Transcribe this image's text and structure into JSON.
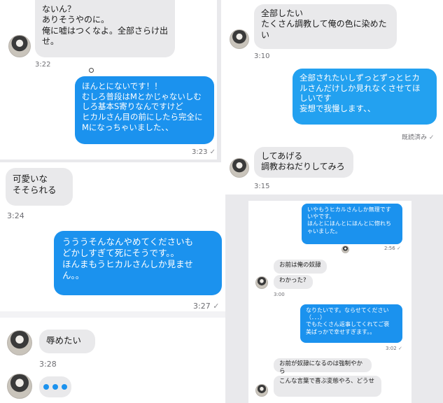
{
  "p1": {
    "m1": "ないん？\nありそうやのに。\n俺に嘘はつくなよ。全部さらけ出\nせ。",
    "t1": "3:22",
    "m2": "ほんとにないです！！\nむしろ普段はMとかじゃないしむ\nしろ基本S寄りなんですけど\nヒカルさん目の前にしたら完全に\nMになっちゃいました、、",
    "t2": "3:23",
    "check": "✓"
  },
  "p2": {
    "m1": "可愛いな\nそそられる",
    "t1": "3:24",
    "m2": "うううそんなんやめてくださいも\nどかしすぎて死にそうです。。\nほんまもうヒカルさんしか見ませ\nん。。",
    "t2": "3:27",
    "check": "✓",
    "m3": "辱めたい",
    "t3": "3:28"
  },
  "p3": {
    "m1": "全部したい\nたくさん調教して俺の色に染めた\nい",
    "t1": "3:10",
    "m2": "全部されたいしずっとずっとヒカ\nルさんだけしか見れなくさせてほ\nしいです\n妄想で我慢します、、",
    "read": "既読済み",
    "check": "✓",
    "m3": "してあげる\n調教おねだりしてみろ",
    "t3": "3:15"
  },
  "p4": {
    "m1": "いやもうヒカルさんしか無理です\nいやです。\nほんとにほんとにほんとに惚れち\nゃいました。",
    "t1": "2:56",
    "m2": "お前は俺の奴隷",
    "m3": "わかった?",
    "t2": "3:00",
    "m4": "なりたいです。ならせてください\n（．．．）\nでもたくさん返事してくれてご褒\n美ばっかで幸せすぎます。。",
    "t3": "3:02",
    "m5": "お前が奴隷になるのは強制やから",
    "m6": "こんな言葉で喜ぶ変態やろ、どうせ",
    "check": "✓"
  }
}
